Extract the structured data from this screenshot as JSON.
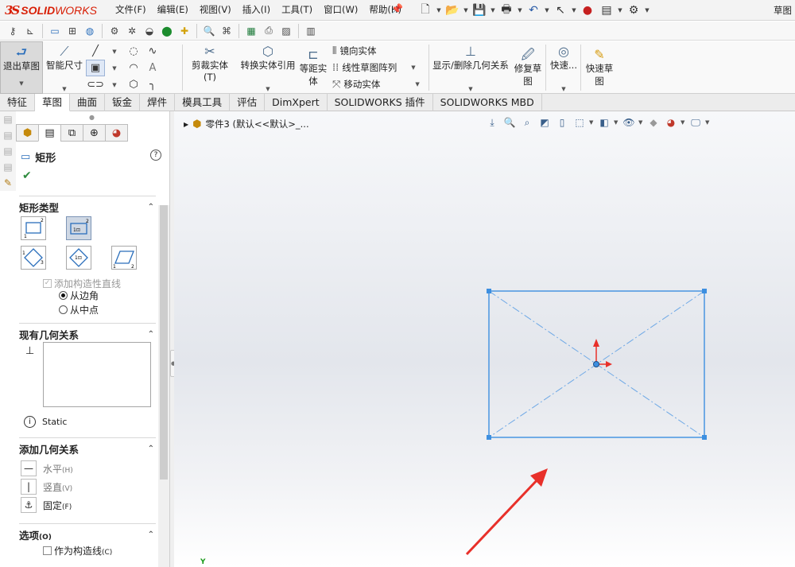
{
  "app": {
    "logo_ds": "3S",
    "logo_text_bold": "SOLID",
    "logo_text_rest": "WORKS",
    "title_right": "草图",
    "brand_color": "#d81e05"
  },
  "menu": [
    "文件(F)",
    "编辑(E)",
    "视图(V)",
    "插入(I)",
    "工具(T)",
    "窗口(W)",
    "帮助(H)"
  ],
  "quick_icons": [
    "new-doc-icon",
    "open-icon",
    "save-icon",
    "print-icon",
    "undo-icon",
    "select-icon",
    "traffic-light-icon",
    "file-props-icon",
    "options-gear-icon"
  ],
  "command_manager": {
    "exit_sketch": "退出草图",
    "smart_dimension": "智能尺寸",
    "trim": "剪裁实体(T)",
    "convert": "转换实体引用",
    "offset_line1": "等距实",
    "offset_line2": "体",
    "mirror": "镜向实体",
    "linear_pattern": "线性草图阵列",
    "move": "移动实体",
    "display_relations": "显示/删除几何关系",
    "repair_line1": "修复草",
    "repair_line2": "图",
    "quick_snaps": "快速...",
    "rapid_line1": "快速草",
    "rapid_line2": "图"
  },
  "tabs": [
    {
      "label": "特征",
      "active": false
    },
    {
      "label": "草图",
      "active": true
    },
    {
      "label": "曲面",
      "active": false
    },
    {
      "label": "钣金",
      "active": false
    },
    {
      "label": "焊件",
      "active": false
    },
    {
      "label": "模具工具",
      "active": false
    },
    {
      "label": "评估",
      "active": false
    },
    {
      "label": "DimXpert",
      "active": false
    },
    {
      "label": "SOLIDWORKS 插件",
      "active": false
    },
    {
      "label": "SOLIDWORKS MBD",
      "active": false
    }
  ],
  "property_manager": {
    "title": "矩形",
    "help": "?",
    "ok": "✔",
    "rect_type": {
      "header": "矩形类型",
      "add_construction": "添加构造性直线",
      "from_corner": "从边角",
      "from_center": "从中点",
      "selected_option": "from_corner"
    },
    "existing_relations": {
      "header": "现有几何关系",
      "status": "Static"
    },
    "add_relations": {
      "header": "添加几何关系",
      "horizontal": "水平",
      "horizontal_key": "(H)",
      "vertical": "竖直",
      "vertical_key": "(V)",
      "fix": "固定",
      "fix_key": "(F)"
    },
    "options": {
      "header": "选项",
      "header_key": "(O)",
      "construction": "作为构造线",
      "construction_key": "(C)"
    }
  },
  "graphics": {
    "tree_label": "零件3  (默认<<默认>_...",
    "triad_y": "Y",
    "sketch_color": "#3d8fe0",
    "arrow_color": "#e8302a"
  }
}
